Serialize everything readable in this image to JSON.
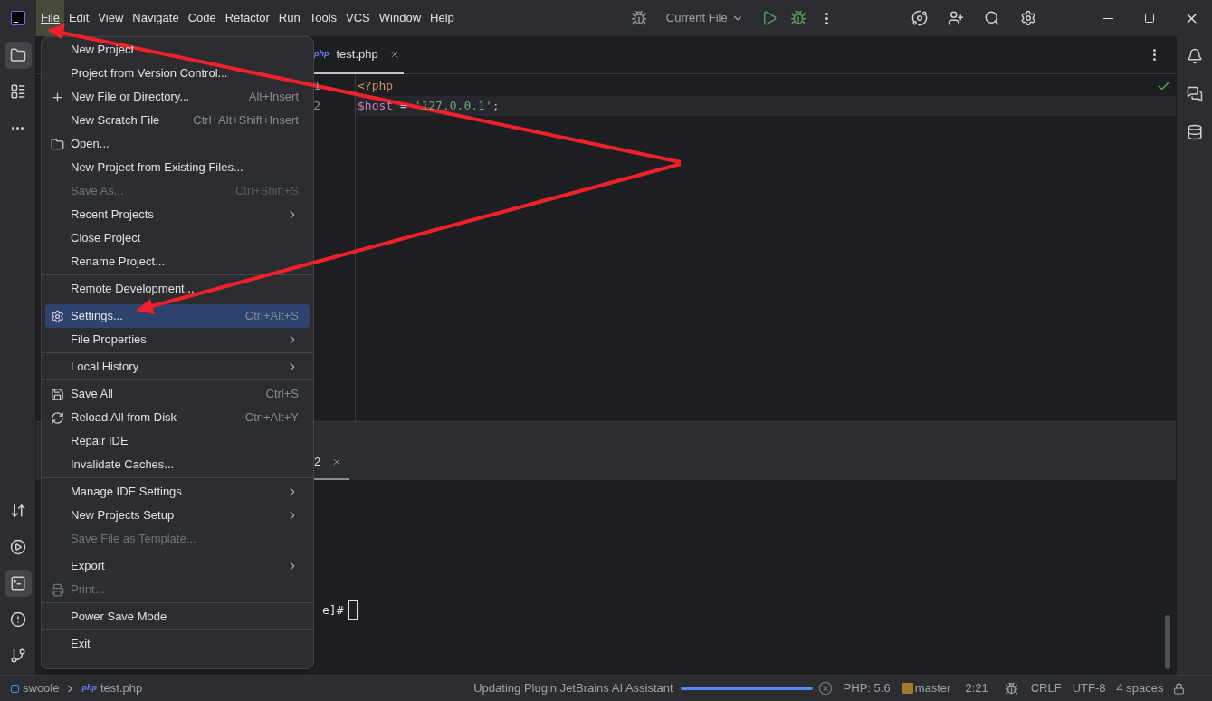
{
  "title_bar": {
    "menu_bar": [
      {
        "label": "File",
        "selected": true
      },
      {
        "label": "Edit",
        "selected": false
      },
      {
        "label": "View",
        "selected": false
      },
      {
        "label": "Navigate",
        "selected": false
      },
      {
        "label": "Code",
        "selected": false
      },
      {
        "label": "Refactor",
        "selected": false
      },
      {
        "label": "Run",
        "selected": false
      },
      {
        "label": "Tools",
        "selected": false
      },
      {
        "label": "VCS",
        "selected": false
      },
      {
        "label": "Window",
        "selected": false
      },
      {
        "label": "Help",
        "selected": false
      }
    ],
    "run_config": "Current File"
  },
  "left_toolbar": {
    "top": [
      {
        "selected": true
      },
      {
        "selected": false
      },
      {
        "selected": false
      }
    ],
    "bottom": [
      {
        "selected": false
      },
      {
        "selected": false
      },
      {
        "selected": true
      },
      {
        "selected": false
      },
      {
        "selected": false
      }
    ]
  },
  "editor": {
    "tabs": [
      {
        "file_type": "php",
        "label": "test.php",
        "selected": true
      }
    ],
    "line_numbers": [
      "1",
      "2"
    ],
    "lines": [
      [
        {
          "kind": "keyword",
          "text": "<?php"
        }
      ],
      [
        {
          "kind": "variable",
          "text": "$host"
        },
        {
          "kind": "plain",
          "text": " = "
        },
        {
          "kind": "string",
          "text": "'127.0.0.1'"
        },
        {
          "kind": "plain",
          "text": ";"
        }
      ]
    ]
  },
  "terminal": {
    "tab_label": "2",
    "prompt": "e]#"
  },
  "file_menu": {
    "groups": [
      [
        {
          "label": "New Project",
          "submenu": false,
          "disabled": false,
          "selected": false
        },
        {
          "label": "Project from Version Control...",
          "submenu": false,
          "disabled": false,
          "selected": false
        },
        {
          "label": "New File or Directory...",
          "shortcut": "Alt+Insert",
          "submenu": false,
          "disabled": false,
          "selected": false
        },
        {
          "label": "New Scratch File",
          "shortcut": "Ctrl+Alt+Shift+Insert",
          "submenu": false,
          "disabled": false,
          "selected": false
        },
        {
          "label": "Open...",
          "submenu": false,
          "disabled": false,
          "selected": false
        },
        {
          "label": "New Project from Existing Files...",
          "submenu": false,
          "disabled": false,
          "selected": false
        },
        {
          "label": "Save As...",
          "shortcut": "Ctrl+Shift+S",
          "submenu": false,
          "disabled": true,
          "selected": false
        },
        {
          "label": "Recent Projects",
          "submenu": true,
          "disabled": false,
          "selected": false
        },
        {
          "label": "Close Project",
          "submenu": false,
          "disabled": false,
          "selected": false
        },
        {
          "label": "Rename Project...",
          "submenu": false,
          "disabled": false,
          "selected": false
        }
      ],
      [
        {
          "label": "Remote Development...",
          "submenu": false,
          "disabled": false,
          "selected": false
        }
      ],
      [
        {
          "label": "Settings...",
          "shortcut": "Ctrl+Alt+S",
          "submenu": false,
          "disabled": false,
          "selected": true
        },
        {
          "label": "File Properties",
          "submenu": true,
          "disabled": false,
          "selected": false
        }
      ],
      [
        {
          "label": "Local History",
          "submenu": true,
          "disabled": false,
          "selected": false
        }
      ],
      [
        {
          "label": "Save All",
          "shortcut": "Ctrl+S",
          "submenu": false,
          "disabled": false,
          "selected": false
        },
        {
          "label": "Reload All from Disk",
          "shortcut": "Ctrl+Alt+Y",
          "submenu": false,
          "disabled": false,
          "selected": false
        },
        {
          "label": "Repair IDE",
          "submenu": false,
          "disabled": false,
          "selected": false
        },
        {
          "label": "Invalidate Caches...",
          "submenu": false,
          "disabled": false,
          "selected": false
        }
      ],
      [
        {
          "label": "Manage IDE Settings",
          "submenu": true,
          "disabled": false,
          "selected": false
        },
        {
          "label": "New Projects Setup",
          "submenu": true,
          "disabled": false,
          "selected": false
        },
        {
          "label": "Save File as Template...",
          "submenu": false,
          "disabled": true,
          "selected": false
        }
      ],
      [
        {
          "label": "Export",
          "submenu": true,
          "disabled": false,
          "selected": false
        },
        {
          "label": "Print...",
          "submenu": false,
          "disabled": true,
          "selected": false
        }
      ],
      [
        {
          "label": "Power Save Mode",
          "submenu": false,
          "disabled": false,
          "selected": false
        }
      ],
      [
        {
          "label": "Exit",
          "submenu": false,
          "disabled": false,
          "selected": false
        }
      ]
    ]
  },
  "status_bar": {
    "breadcrumbs": [
      "swoole",
      "test.php"
    ],
    "file_type": "php",
    "task": "Updating Plugin JetBrains AI Assistant",
    "progress": {
      "level": 1
    },
    "php": "PHP: 5.6",
    "branch": "master",
    "position": "2:21",
    "line_separator": "CRLF",
    "encoding": "UTF-8",
    "indent": "4 spaces"
  }
}
